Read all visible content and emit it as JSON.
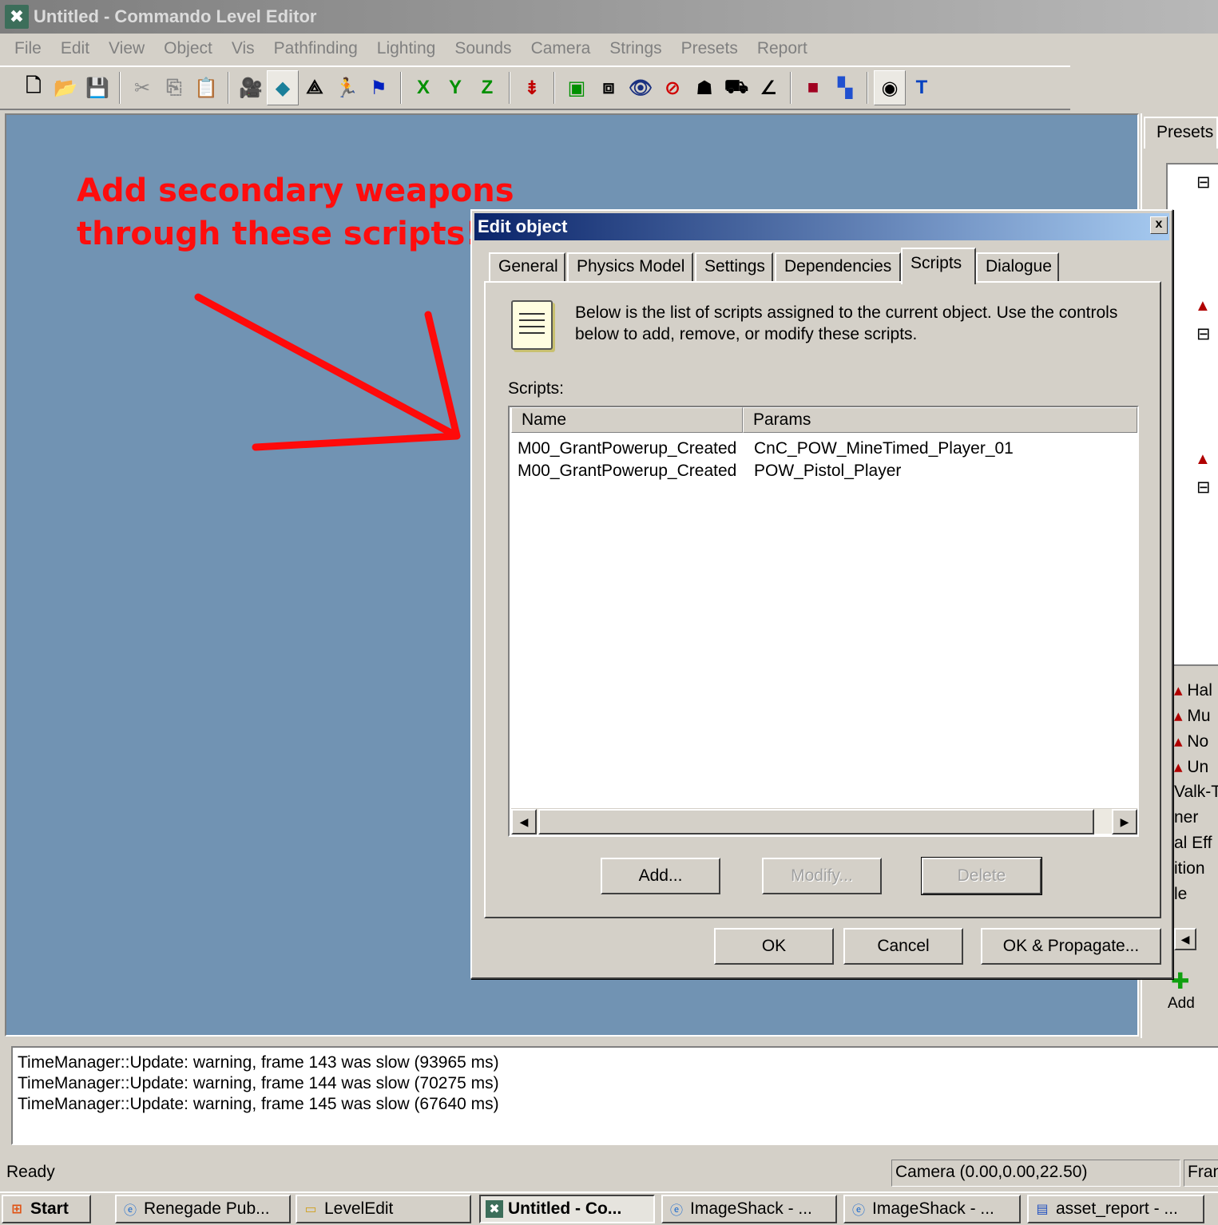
{
  "window": {
    "title": "Untitled - Commando Level Editor"
  },
  "menu": [
    "File",
    "Edit",
    "View",
    "Object",
    "Vis",
    "Pathfinding",
    "Lighting",
    "Sounds",
    "Camera",
    "Strings",
    "Presets",
    "Report"
  ],
  "toolbar": {
    "x_label": "X",
    "y_label": "Y",
    "z_label": "Z",
    "t_label": "T"
  },
  "annotation": {
    "text": "Add secondary weapons through these scripts!"
  },
  "presets_panel": {
    "tab_label": "Presets",
    "items": [
      "Hal",
      "Mu",
      "No",
      "Un",
      "Valk-T",
      "ner",
      "al Eff",
      "ition",
      "le"
    ],
    "add_label": "Add"
  },
  "dialog": {
    "title": "Edit object",
    "close_label": "x",
    "tabs": [
      "General",
      "Physics Model",
      "Settings",
      "Dependencies",
      "Scripts",
      "Dialogue"
    ],
    "active_tab": "Scripts",
    "description": "Below is the list of scripts assigned to the current object.  Use the controls below to add, remove, or modify these scripts.",
    "scripts_label": "Scripts:",
    "columns": [
      "Name",
      "Params"
    ],
    "rows": [
      {
        "name": "M00_GrantPowerup_Created",
        "params": "CnC_POW_MineTimed_Player_01"
      },
      {
        "name": "M00_GrantPowerup_Created",
        "params": "POW_Pistol_Player"
      }
    ],
    "buttons": {
      "add": "Add...",
      "modify": "Modify...",
      "delete": "Delete"
    },
    "footer": {
      "ok": "OK",
      "cancel": "Cancel",
      "ok_propagate": "OK & Propagate..."
    }
  },
  "log": [
    "TimeManager::Update: warning, frame 143 was slow (93965 ms)",
    "TimeManager::Update: warning, frame 144 was slow (70275 ms)",
    "TimeManager::Update: warning, frame 145 was slow (67640 ms)"
  ],
  "status": {
    "ready": "Ready",
    "camera": "Camera (0.00,0.00,22.50)",
    "frame": "Fran"
  },
  "taskbar": {
    "start": "Start",
    "tasks": [
      "Renegade Pub...",
      "LevelEdit",
      "Untitled - Co...",
      "ImageShack - ...",
      "ImageShack - ...",
      "asset_report - ..."
    ]
  },
  "colors": {
    "viewport": "#7193b3",
    "annotation": "#ff0d0d",
    "dialog_title": "#0a246a"
  }
}
